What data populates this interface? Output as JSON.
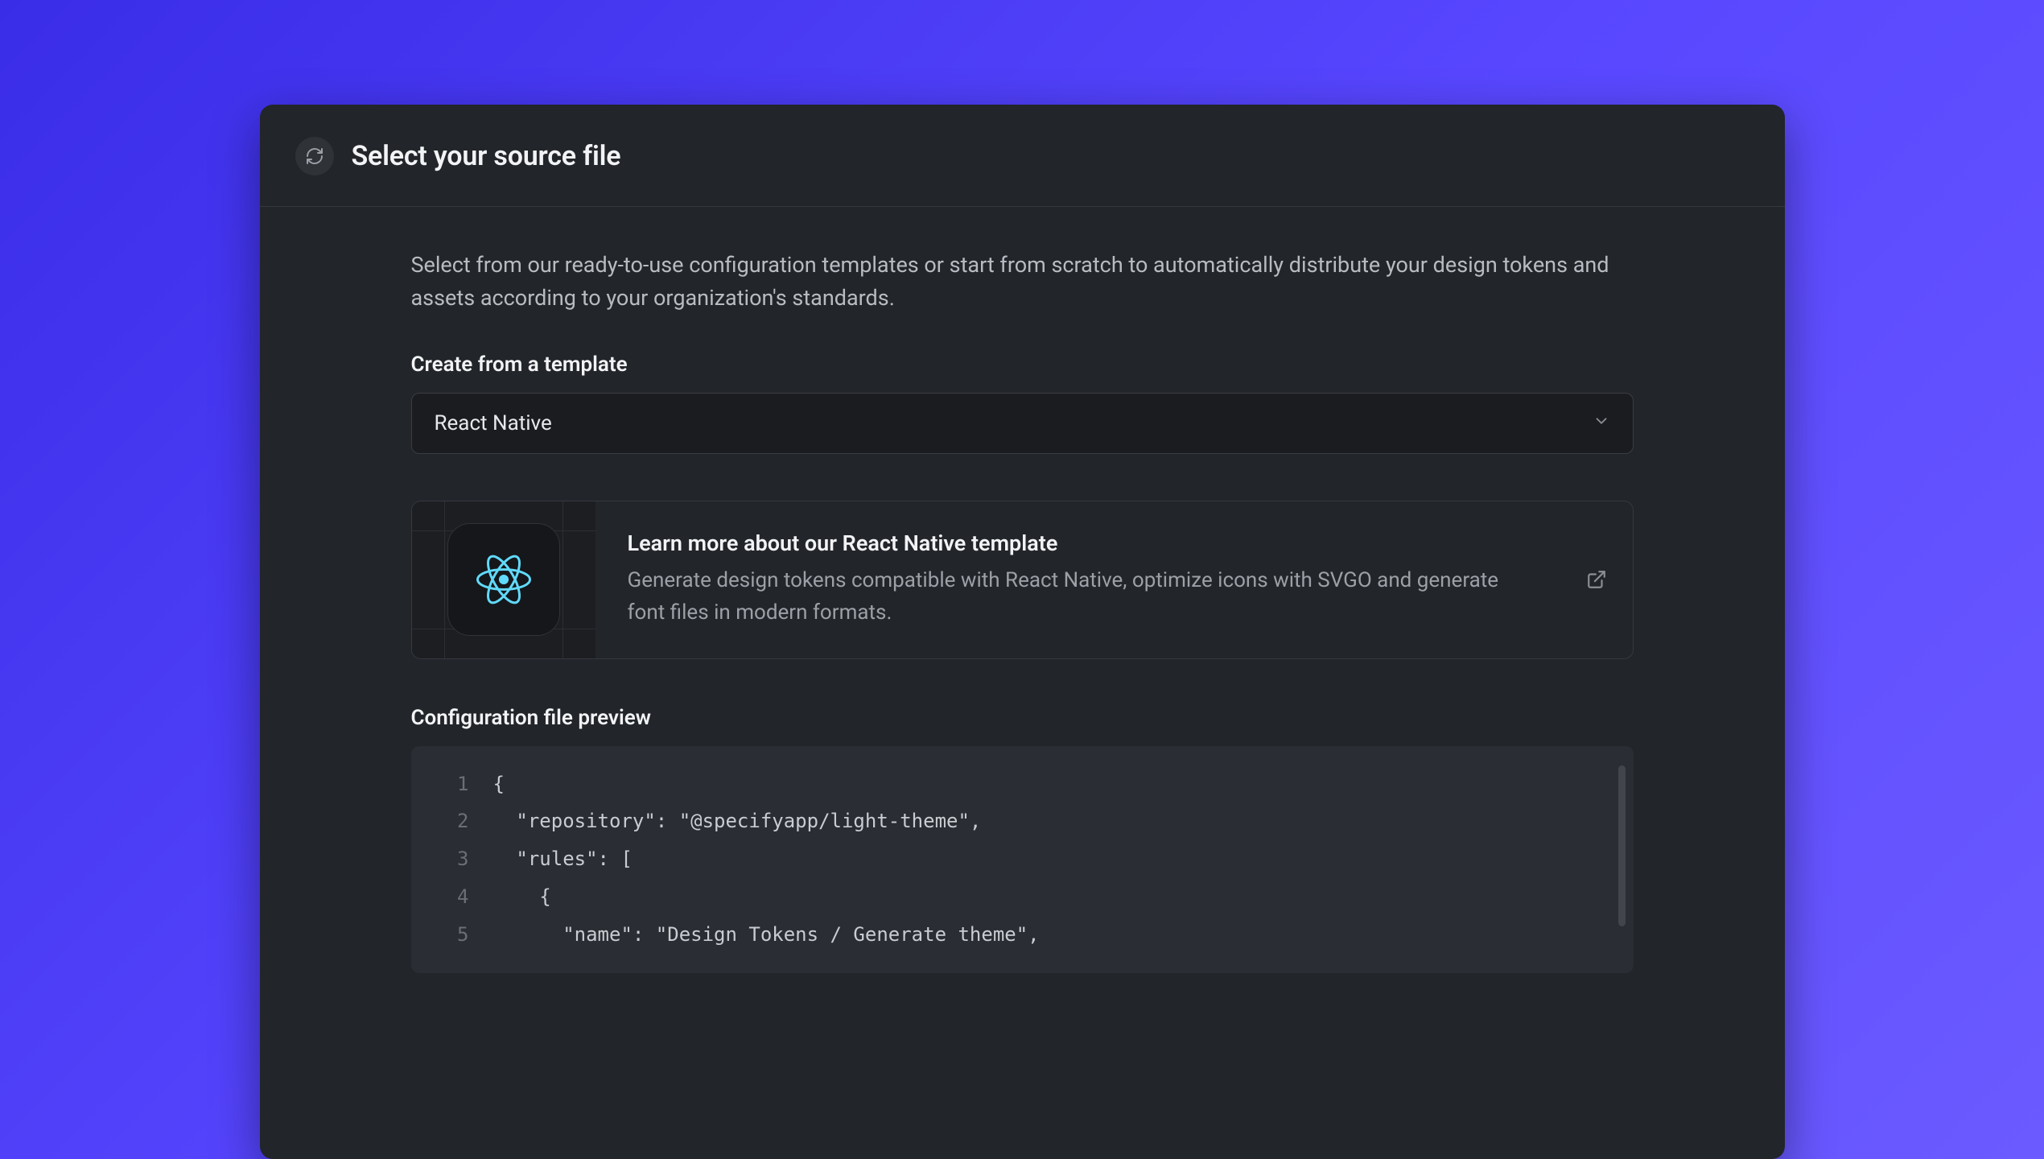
{
  "header": {
    "title": "Select your source file"
  },
  "intro": "Select from our ready-to-use configuration templates or start from scratch to automatically distribute your design tokens and assets according to your organization's standards.",
  "template_section": {
    "label": "Create from a template",
    "selected": "React Native"
  },
  "info_card": {
    "title": "Learn more about our React Native template",
    "description": "Generate design tokens compatible with React Native, optimize icons with SVGO and generate font files in modern formats."
  },
  "preview_section": {
    "label": "Configuration file preview"
  },
  "code_lines": [
    {
      "n": "1",
      "t": "{"
    },
    {
      "n": "2",
      "t": "  \"repository\": \"@specifyapp/light-theme\","
    },
    {
      "n": "3",
      "t": "  \"rules\": ["
    },
    {
      "n": "4",
      "t": "    {"
    },
    {
      "n": "5",
      "t": "      \"name\": \"Design Tokens / Generate theme\","
    }
  ]
}
